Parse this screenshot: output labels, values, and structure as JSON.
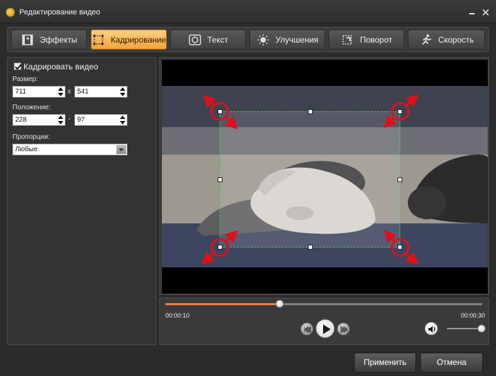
{
  "window": {
    "title": "Редактирование видео"
  },
  "tabs": [
    {
      "label": "Эффекты",
      "icon": "film-icon"
    },
    {
      "label": "Кадрирование",
      "icon": "crop-icon",
      "active": true
    },
    {
      "label": "Текст",
      "icon": "text-icon"
    },
    {
      "label": "Улучшения",
      "icon": "brightness-icon"
    },
    {
      "label": "Поворот",
      "icon": "rotate-icon"
    },
    {
      "label": "Скорость",
      "icon": "runner-icon"
    }
  ],
  "crop": {
    "enabled_label": "Кадрировать видео",
    "enabled": true,
    "size_label": "Размер:",
    "width": "711",
    "height": "541",
    "size_sep": "x",
    "position_label": "Положение:",
    "pos_x": "228",
    "pos_y": "97",
    "pos_sep": "-",
    "aspect_label": "Пропорции:",
    "aspect_value": "Любые"
  },
  "player": {
    "current_time": "00:00:10",
    "total_time": "00:00:30",
    "progress": 0.36,
    "volume": 1.0
  },
  "buttons": {
    "apply": "Применить",
    "cancel": "Отмена"
  },
  "colors": {
    "accent": "#f4a33b",
    "crop_border": "#3fd03f",
    "arrow": "#e0101a",
    "progress": "#f47f3a"
  }
}
